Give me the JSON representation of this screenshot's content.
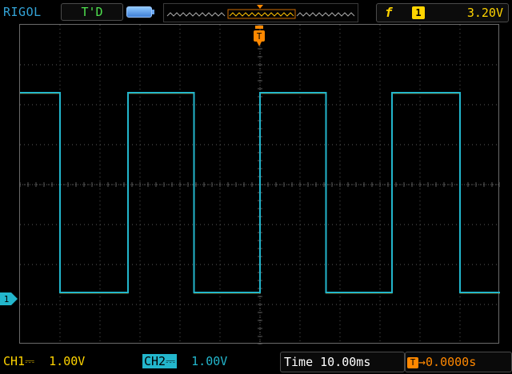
{
  "header": {
    "brand": "RIGOL",
    "status": "T'D",
    "trigger_edge_symbol": "f",
    "trigger_source": "1",
    "trigger_level": "3.20V"
  },
  "footer": {
    "ch1_label": "CH1",
    "ch1_coupling": "⎓",
    "ch1_scale": "1.00V",
    "ch2_label": "CH2",
    "ch2_coupling": "⎓",
    "ch2_scale": "1.00V",
    "time_label": "Time",
    "time_value": "10.00ms",
    "trigger_offset_icon": "T",
    "trigger_offset_value": "→0.0000s"
  },
  "markers": {
    "trigger_marker": "T",
    "channel_marker": "1"
  },
  "colors": {
    "ch1": "#ffd400",
    "ch2": "#23b6cc",
    "trigger": "#ff8800",
    "grid": "#5a5a5a"
  },
  "chart_data": {
    "type": "line",
    "title": "",
    "xlabel": "",
    "ylabel": "",
    "divisions_x": 12,
    "divisions_y": 8,
    "time_per_div_ms": 10,
    "volts_per_div": 1.0,
    "series": [
      {
        "name": "CH2",
        "color": "#23b6cc",
        "levels_div": {
          "high": 2.3,
          "low": -2.7
        },
        "edges_div": [
          -6.0,
          -5.0,
          -3.3,
          -1.65,
          0.0,
          1.65,
          3.3,
          5.0,
          6.0
        ]
      }
    ]
  }
}
